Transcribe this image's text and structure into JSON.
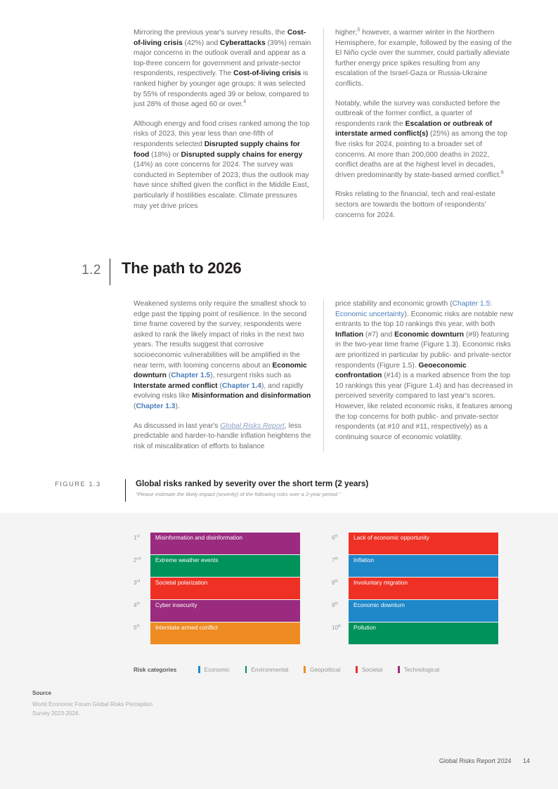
{
  "block_one": {
    "left_column": [
      "Mirroring the previous year's survey results, the <b>Cost-of-living crisis</b> (42%) and <b>Cyberattacks</b> (39%) remain major concerns in the outlook overall and appear as a top-three concern for government and private-sector respondents, respectively. The <b>Cost-of-living crisis</b> is ranked higher by younger age groups: it was selected by 55% of respondents aged 39 or below, compared to just 28% of those aged 60 or over.<sup>4</sup>",
      "Although energy and food crises ranked among the top risks of 2023, this year less than one-fifth of respondents selected <b>Disrupted supply chains for food</b> (18%) or <b>Disrupted supply chains for energy</b> (14%) as core concerns for 2024. The survey was conducted in September of 2023, thus the outlook may have since shifted given the conflict in the Middle East, particularly if hostilities escalate. Climate pressures may yet drive prices"
    ],
    "right_column": [
      "higher;<sup>5</sup> however, a warmer winter in the Northern Hemisphere, for example, followed by the easing of the El Ni&ntilde;o cycle over the summer, could partially alleviate further energy price spikes resulting from any escalation of the Israel-Gaza or Russia-Ukraine conflicts.",
      "Notably, while the survey was conducted before the outbreak of the former conflict, a quarter of respondents rank the <b>Escalation or outbreak of interstate armed conflict(s)</b> (25%) as among the top five risks for 2024, pointing to a broader set of concerns. At more than 200,000 deaths in 2022, conflict deaths are at the highest level in decades, driven predominantly by state-based armed conflict.<sup>6</sup>",
      "Risks relating to the financial, tech and real-estate sectors are towards the bottom of respondents' concerns for 2024."
    ]
  },
  "section": {
    "number": "1.2",
    "title": "The path to 2026"
  },
  "block_two": {
    "left_column": [
      "Weakened systems only require the smallest shock to edge past the tipping point of resilience. In the second time frame covered by the survey, respondents were asked to rank the likely impact of risks in the next two years. The results suggest that corrosive socioeconomic vulnerabilities will be amplified in the near term, with looming concerns about an <b>Economic downturn</b> (<span class=\"lnk-b\">Chapter 1.5</span>), resurgent risks such as <b>Interstate armed conflict</b> (<span class=\"lnk-b\">Chapter 1.4</span>), and rapidly evolving risks like <b>Misinformation and disinformation</b> (<span class=\"lnk-b\">Chapter 1.3</span>).",
      "As discussed in last year's <span class=\"ital-lnk\">Global Risks Report</span>, less predictable and harder-to-handle inflation heightens the risk of miscalibration of efforts to balance"
    ],
    "right_column": [
      "price stability and economic growth (<span class=\"lnk\">Chapter 1.5: Economic uncertainty</span>). Economic risks are notable new entrants to the top 10 rankings this year, with both <b>Inflation</b> (#7) and <b>Economic downturn</b> (#9) featuring in the two-year time frame (Figure 1.3). Economic risks are prioritized in particular by public- and private-sector respondents (Figure 1.5). <b>Geoeconomic confrontation</b> (#14) is a marked absence from the top 10 rankings this year (Figure 1.4) and has decreased in perceived severity compared to last year's scores. However, like related economic risks, it features among the top concerns for both public- and private-sector respondents (at #10 and #11, respectively) as a continuing source of economic volatility."
    ]
  },
  "figure": {
    "label": "FIGURE 1.3",
    "title": "Global risks ranked by severity over the short term (2 years)",
    "subtitle": "\"Please estimate the likely impact (severity) of the following risks over a 2-year period.\""
  },
  "chart_data": {
    "type": "bar",
    "title": "Global risks ranked by severity over the short term (2 years)",
    "subtitle": "\"Please estimate the likely impact (severity) of the following risks over a 2-year period.\"",
    "orientation": "horizontal-rank",
    "note": "Equal-length ranked bars; colour encodes risk category. No numeric axis is shown.",
    "categories": [
      "Misinformation and disinformation",
      "Extreme weather events",
      "Societal polarization",
      "Cyber insecurity",
      "Interstate armed conflict",
      "Lack of economic opportunity",
      "Inflation",
      "Involuntary migration",
      "Economic downturn",
      "Pollution"
    ],
    "ranks": [
      "1st",
      "2nd",
      "3rd",
      "4th",
      "5th",
      "6th",
      "7th",
      "8th",
      "9th",
      "10th"
    ],
    "values": [
      1,
      2,
      3,
      4,
      5,
      6,
      7,
      8,
      9,
      10
    ],
    "series": [
      {
        "name": "Risk category",
        "values": [
          "Technological",
          "Environmental",
          "Societal",
          "Technological",
          "Geopolitical",
          "Societal",
          "Economic",
          "Societal",
          "Economic",
          "Environmental"
        ]
      }
    ],
    "legend_position": "bottom",
    "grid": false,
    "left_column_items": [
      {
        "rank": "1",
        "suffix": "st",
        "label": "Misinformation and disinformation",
        "category": "Technological",
        "color": "#9a2b7e"
      },
      {
        "rank": "2",
        "suffix": "nd",
        "label": "Extreme weather events",
        "category": "Environmental",
        "color": "#00925b"
      },
      {
        "rank": "3",
        "suffix": "rd",
        "label": "Societal polarization",
        "category": "Societal",
        "color": "#ee3124"
      },
      {
        "rank": "4",
        "suffix": "th",
        "label": "Cyber insecurity",
        "category": "Technological",
        "color": "#9a2b7e"
      },
      {
        "rank": "5",
        "suffix": "th",
        "label": "Interstate armed conflict",
        "category": "Geopolitical",
        "color": "#ee8b22"
      }
    ],
    "right_column_items": [
      {
        "rank": "6",
        "suffix": "th",
        "label": "Lack of economic opportunity",
        "category": "Societal",
        "color": "#ee3124"
      },
      {
        "rank": "7",
        "suffix": "th",
        "label": "Inflation",
        "category": "Economic",
        "color": "#1f88c9"
      },
      {
        "rank": "8",
        "suffix": "th",
        "label": "Involuntary migration",
        "category": "Societal",
        "color": "#ee3124"
      },
      {
        "rank": "9",
        "suffix": "th",
        "label": "Economic downturn",
        "category": "Economic",
        "color": "#1f88c9"
      },
      {
        "rank": "10",
        "suffix": "th",
        "label": "Pollution",
        "category": "Environmental",
        "color": "#00925b"
      }
    ]
  },
  "legend": {
    "title": "Risk categories",
    "items": [
      {
        "label": "Economic",
        "color": "#1f88c9"
      },
      {
        "label": "Environmental",
        "color": "#00925b"
      },
      {
        "label": "Geopolitical",
        "color": "#ee8b22"
      },
      {
        "label": "Societal",
        "color": "#ee3124"
      },
      {
        "label": "Technological",
        "color": "#9a2b7e"
      }
    ]
  },
  "source": {
    "label": "Source",
    "text": "World Economic Forum Global Risks Perception Survey 2023-2024."
  },
  "footer": {
    "title": "Global Risks Report 2024",
    "page": "14"
  }
}
